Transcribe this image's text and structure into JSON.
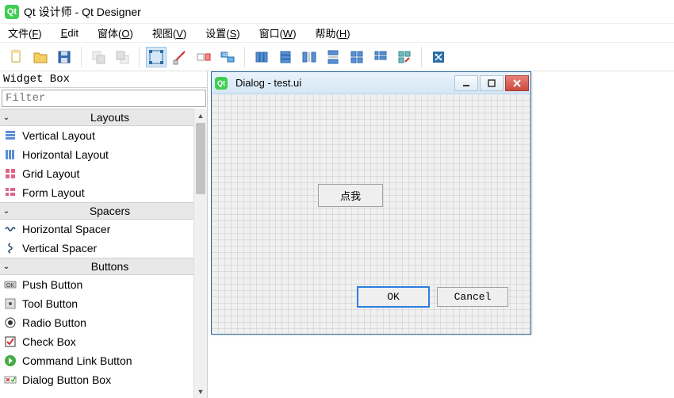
{
  "app": {
    "title": "Qt 设计师 - Qt Designer",
    "logo_text": "Qt"
  },
  "menu": {
    "file": {
      "label": "文件(",
      "mnemonic": "F",
      "suffix": ")"
    },
    "edit": {
      "label": "",
      "mnemonic": "E",
      "suffix": "dit"
    },
    "form": {
      "label": "窗体(",
      "mnemonic": "O",
      "suffix": ")"
    },
    "view": {
      "label": "视图(",
      "mnemonic": "V",
      "suffix": ")"
    },
    "settings": {
      "label": "设置(",
      "mnemonic": "S",
      "suffix": ")"
    },
    "window": {
      "label": "窗口(",
      "mnemonic": "W",
      "suffix": ")"
    },
    "help": {
      "label": "帮助(",
      "mnemonic": "H",
      "suffix": ")"
    }
  },
  "sidebar": {
    "title": "Widget Box",
    "filter_placeholder": "Filter",
    "categories": [
      {
        "name": "Layouts",
        "items": [
          {
            "label": "Vertical Layout",
            "icon": "vlayout"
          },
          {
            "label": "Horizontal Layout",
            "icon": "hlayout"
          },
          {
            "label": "Grid Layout",
            "icon": "grid"
          },
          {
            "label": "Form Layout",
            "icon": "form"
          }
        ]
      },
      {
        "name": "Spacers",
        "items": [
          {
            "label": "Horizontal Spacer",
            "icon": "hspacer"
          },
          {
            "label": "Vertical Spacer",
            "icon": "vspacer"
          }
        ]
      },
      {
        "name": "Buttons",
        "items": [
          {
            "label": "Push Button",
            "icon": "pushbtn"
          },
          {
            "label": "Tool Button",
            "icon": "toolbtn"
          },
          {
            "label": "Radio Button",
            "icon": "radio"
          },
          {
            "label": "Check Box",
            "icon": "checkbox"
          },
          {
            "label": "Command Link Button",
            "icon": "cmdlink"
          },
          {
            "label": "Dialog Button Box",
            "icon": "dlgbtn"
          }
        ]
      }
    ]
  },
  "dialog": {
    "title": "Dialog - test.ui",
    "center_button": "点我",
    "ok": "OK",
    "cancel": "Cancel"
  }
}
